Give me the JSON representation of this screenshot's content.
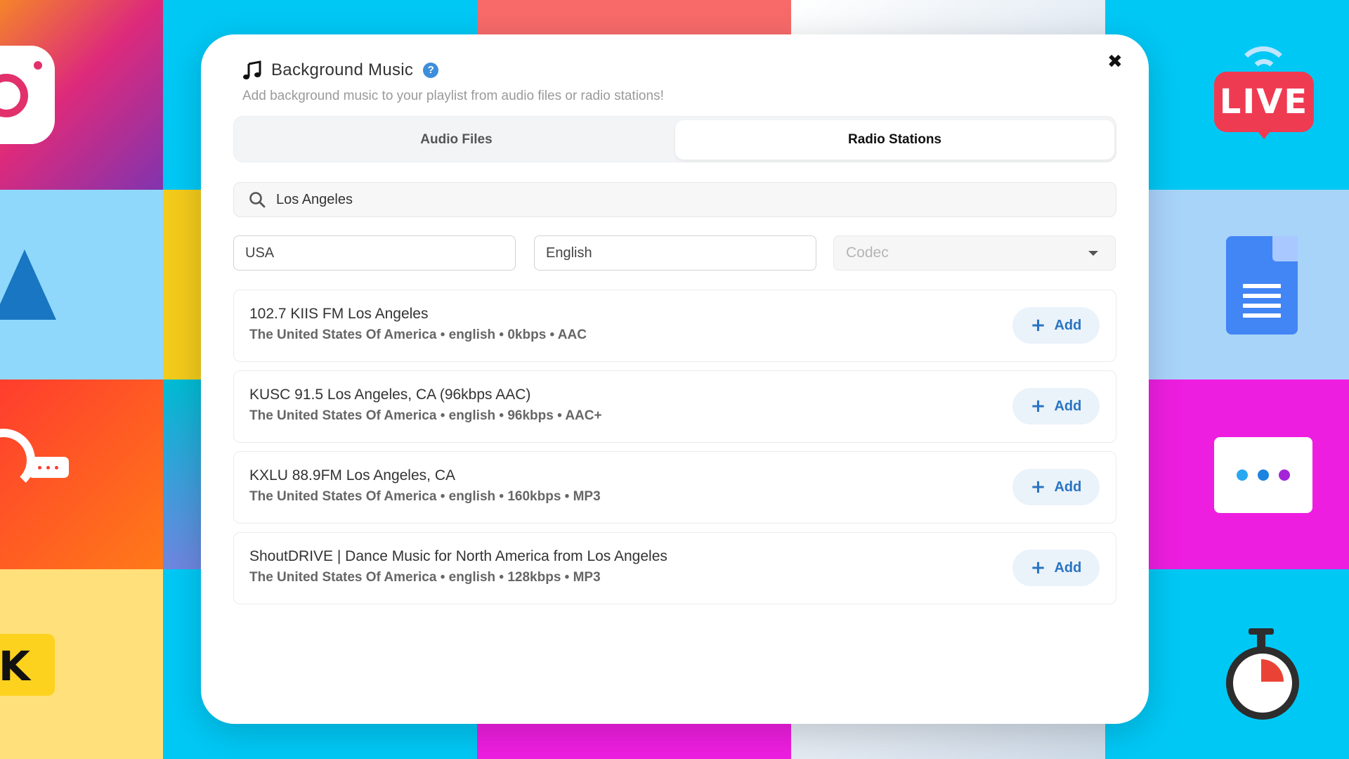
{
  "dialog": {
    "title": "Background Music",
    "subtitle": "Add background music to your playlist from audio files or radio stations!",
    "help_symbol": "?",
    "close_symbol": "✖"
  },
  "tabs": [
    {
      "label": "Audio Files",
      "active": false
    },
    {
      "label": "Radio Stations",
      "active": true
    }
  ],
  "search": {
    "value": "Los Angeles"
  },
  "filters": {
    "country": "USA",
    "language": "English",
    "codec_placeholder": "Codec"
  },
  "stations": [
    {
      "name": "102.7 KIIS FM Los Angeles",
      "meta": "The United States Of America • english • 0kbps • AAC",
      "add_label": "Add"
    },
    {
      "name": "KUSC 91.5 Los Angeles, CA (96kbps AAC)",
      "meta": "The United States Of America • english • 96kbps • AAC+",
      "add_label": "Add"
    },
    {
      "name": "KXLU 88.9FM Los Angeles, CA",
      "meta": "The United States Of America • english • 160kbps • MP3",
      "add_label": "Add"
    },
    {
      "name": "ShoutDRIVE | Dance Music for North America from Los Angeles",
      "meta": "The United States Of America • english • 128kbps • MP3",
      "add_label": "Add"
    }
  ],
  "add_icon": "+",
  "background": {
    "live_badge": "LIVE",
    "k_badge": "K",
    "icons": [
      "instagram-icon",
      "live-icon",
      "mountain-icon",
      "google-docs-icon",
      "podcast-chat-icon",
      "dots-card-icon",
      "k-badge-icon",
      "stopwatch-icon"
    ]
  },
  "colors": {
    "accent": "#2a74c2",
    "add_button_bg": "#eaf2fa",
    "help_icon": "#3d8edb"
  }
}
